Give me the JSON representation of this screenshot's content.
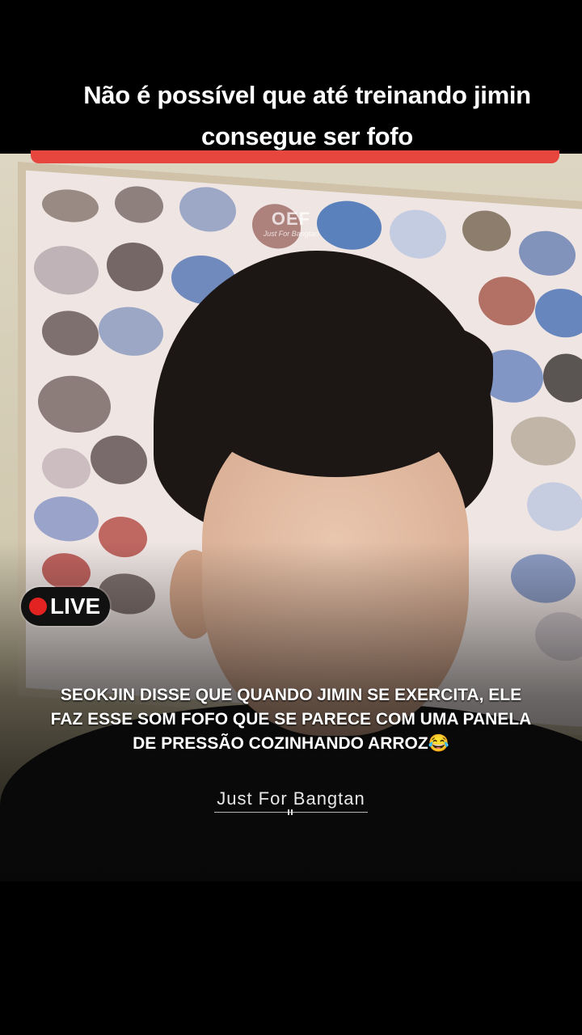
{
  "caption": {
    "line1": "Não é possível que até treinando jimin",
    "line2": "consegue ser fofo"
  },
  "video": {
    "watermark_logo": "OEF",
    "watermark_small": "Just For Bangtan",
    "live_label": "LIVE",
    "subtitle_line1": "SEOKJIN DISSE QUE QUANDO JIMIN SE EXERCITA, ELE",
    "subtitle_line2": "FAZ ESSE SOM FOFO QUE SE PARECE COM UMA PANELA",
    "subtitle_line3": "DE PRESSÃO COZINHANDO ARROZ😂",
    "watermark_bottom": "Just For Bangtan"
  },
  "colors": {
    "accent_line": "#e7463f",
    "live_dot": "#e32222"
  }
}
